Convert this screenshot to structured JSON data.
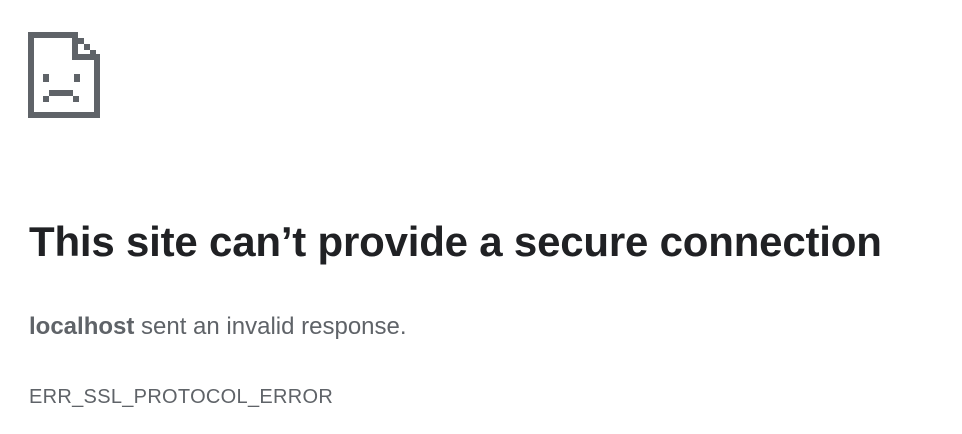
{
  "error_page": {
    "icon": "sad-page-icon",
    "title": "This site can’t provide a secure connection",
    "host": "localhost",
    "summary_rest": " sent an invalid response.",
    "error_code": "ERR_SSL_PROTOCOL_ERROR"
  },
  "colors": {
    "title": "#202124",
    "body_text": "#5f6368",
    "icon": "#5f6368",
    "background": "#ffffff"
  }
}
